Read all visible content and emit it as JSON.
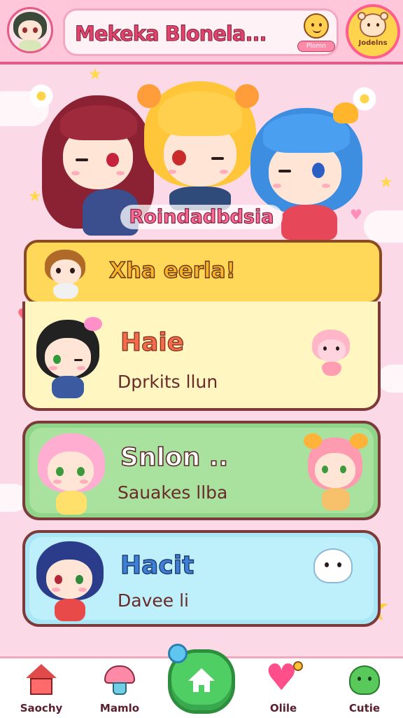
{
  "header": {
    "app_title": "Mekeka Blonela...",
    "promo_label": "Plomn",
    "profile_label": "Jodelns"
  },
  "hero": {
    "title": "Roindadbdsia"
  },
  "banner": {
    "text": "Xha eerla!"
  },
  "cards": [
    {
      "title": "Haie",
      "subtitle": "Dprkits llun",
      "title_color": "#f26b4a"
    },
    {
      "title": "Snlon ..",
      "subtitle": "Sauakes llba",
      "title_color": "#ffffff"
    },
    {
      "title": "Hacit",
      "subtitle": "Davee li",
      "title_color": "#3f7fd6"
    }
  ],
  "nav": {
    "items": [
      {
        "label": "Saochy",
        "icon": "house-icon"
      },
      {
        "label": "Mamlo",
        "icon": "mushroom-icon"
      },
      {
        "label": "",
        "icon": "home-icon"
      },
      {
        "label": "Olile",
        "icon": "heart-icon"
      },
      {
        "label": "Cutie",
        "icon": "slime-icon"
      }
    ]
  },
  "colors": {
    "accent_pink": "#e35b86",
    "background": "#fbd9e6",
    "banner_yellow": "#ffd85a",
    "card_green": "#8fd488",
    "card_blue": "#a9e6f6",
    "home_green": "#4fce64"
  }
}
